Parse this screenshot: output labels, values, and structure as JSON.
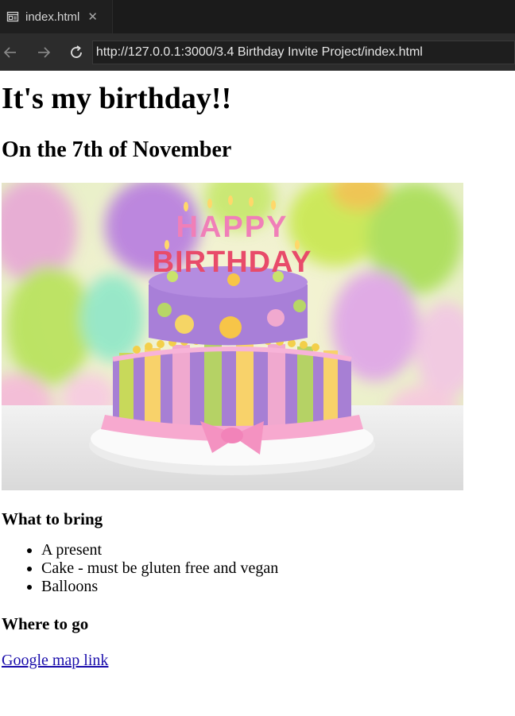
{
  "browser": {
    "tab_title": "index.html",
    "tab_close": "✕",
    "url": "http://127.0.0.1:3000/3.4 Birthday Invite Project/index.html"
  },
  "page": {
    "title": "It's my birthday!!",
    "date_heading": "On the 7th of November",
    "image_candles_text": "HAPPY BIRTHDAY",
    "bring_heading": "What to bring",
    "bring_items": [
      "A present",
      "Cake - must be gluten free and vegan",
      "Balloons"
    ],
    "where_heading": "Where to go",
    "map_link": "Google map link"
  }
}
